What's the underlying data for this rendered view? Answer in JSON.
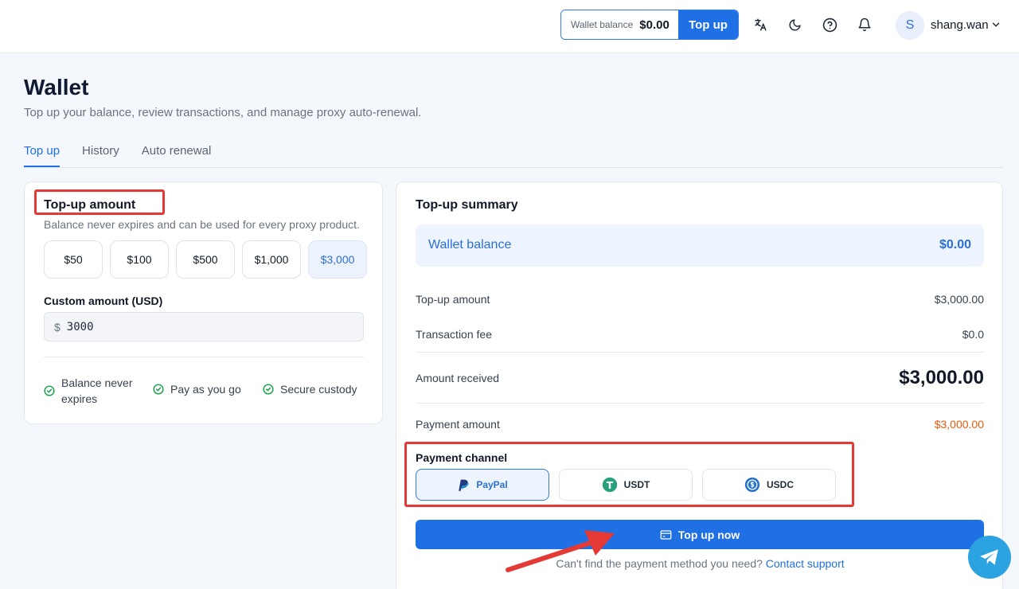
{
  "header": {
    "wallet_label": "Wallet balance",
    "wallet_value": "$0.00",
    "topup_label": "Top up",
    "avatar_initial": "S",
    "username": "shang.wan",
    "icons": [
      "translate-icon",
      "moon-icon",
      "help-icon",
      "bell-icon",
      "chevron-down-icon"
    ]
  },
  "page": {
    "title": "Wallet",
    "subtitle": "Top up your balance, review transactions, and manage proxy auto-renewal."
  },
  "tabs": [
    {
      "label": "Top up",
      "active": true
    },
    {
      "label": "History",
      "active": false
    },
    {
      "label": "Auto renewal",
      "active": false
    }
  ],
  "topup": {
    "title": "Top-up amount",
    "subtitle": "Balance never expires and can be used for every proxy product.",
    "amounts": [
      "$50",
      "$100",
      "$500",
      "$1,000",
      "$3,000"
    ],
    "selected_amount": "$3,000",
    "custom_label": "Custom amount (USD)",
    "custom_prefix": "$",
    "custom_value": "3000",
    "features": [
      "Balance never expires",
      "Pay as you go",
      "Secure custody"
    ]
  },
  "summary": {
    "title": "Top-up summary",
    "balance_label": "Wallet balance",
    "balance_value": "$0.00",
    "topup_amount_label": "Top-up amount",
    "topup_amount_value": "$3,000.00",
    "fee_label": "Transaction fee",
    "fee_value": "$0.0",
    "received_label": "Amount received",
    "received_value": "$3,000.00",
    "payment_label": "Payment amount",
    "payment_value": "$3,000.00",
    "channel_label": "Payment channel",
    "channels": [
      {
        "name": "PayPal",
        "icon": "paypal-icon",
        "selected": true
      },
      {
        "name": "USDT",
        "icon": "tether-icon",
        "selected": false
      },
      {
        "name": "USDC",
        "icon": "usdc-icon",
        "selected": false
      }
    ],
    "topup_now_label": "Top up now",
    "help_text": "Can't find the payment method you need?",
    "help_link": "Contact support"
  },
  "colors": {
    "accent": "#1f6fe5",
    "orange": "#e8590c",
    "annotation_red": "#e53935",
    "telegram": "#2aa3e0"
  }
}
